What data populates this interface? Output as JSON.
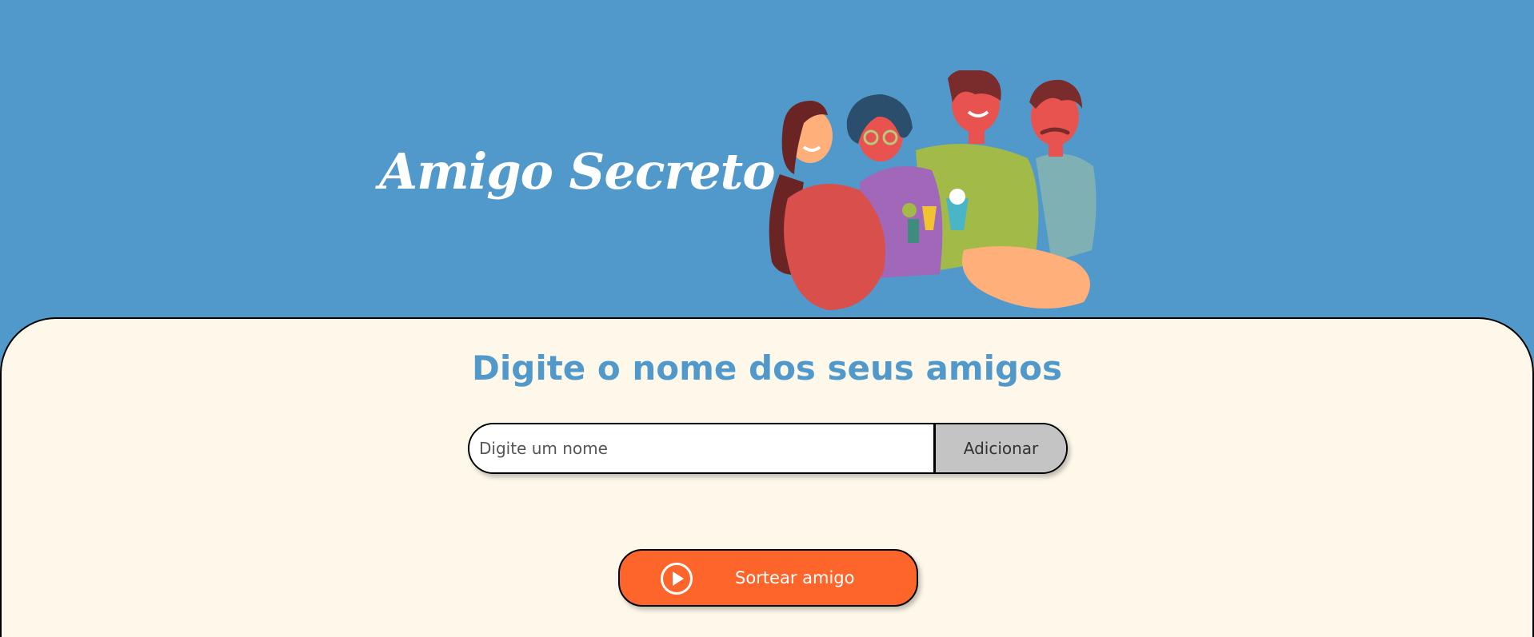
{
  "header": {
    "title": "Amigo Secreto",
    "illustration": "friends-celebrating-illustration"
  },
  "main": {
    "subtitle": "Digite o nome dos seus amigos",
    "name_input": {
      "value": "",
      "placeholder": "Digite um nome"
    },
    "add_button_label": "Adicionar",
    "draw_button": {
      "label": "Sortear amigo",
      "icon": "play-circle-icon"
    }
  },
  "colors": {
    "header_background": "#5299CB",
    "panel_background": "#FEF8EA",
    "subtitle": "#5299CB",
    "add_button": "#C4C4C4",
    "draw_button": "#FE652B"
  }
}
